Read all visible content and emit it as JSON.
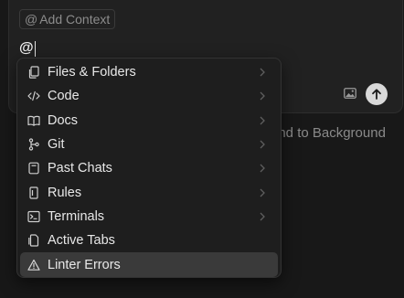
{
  "composer": {
    "context_chip_at": "@",
    "context_chip_label": "Add Context",
    "input_value": "@"
  },
  "background_hint": "end to Background",
  "menu": {
    "items": [
      {
        "label": "Files & Folders",
        "icon": "files-icon",
        "submenu": true
      },
      {
        "label": "Code",
        "icon": "code-icon",
        "submenu": true
      },
      {
        "label": "Docs",
        "icon": "book-icon",
        "submenu": true
      },
      {
        "label": "Git",
        "icon": "git-branch-icon",
        "submenu": true
      },
      {
        "label": "Past Chats",
        "icon": "chat-history-icon",
        "submenu": true
      },
      {
        "label": "Rules",
        "icon": "rules-icon",
        "submenu": true
      },
      {
        "label": "Terminals",
        "icon": "terminal-icon",
        "submenu": true
      },
      {
        "label": "Active Tabs",
        "icon": "tabs-icon",
        "submenu": false
      },
      {
        "label": "Linter Errors",
        "icon": "warning-icon",
        "submenu": false,
        "selected": true
      }
    ]
  },
  "colors": {
    "background": "#181818",
    "menu_bg": "#1e1e1e",
    "selected_bg": "#3a3a3a",
    "send_button": "#d9d9d9"
  }
}
